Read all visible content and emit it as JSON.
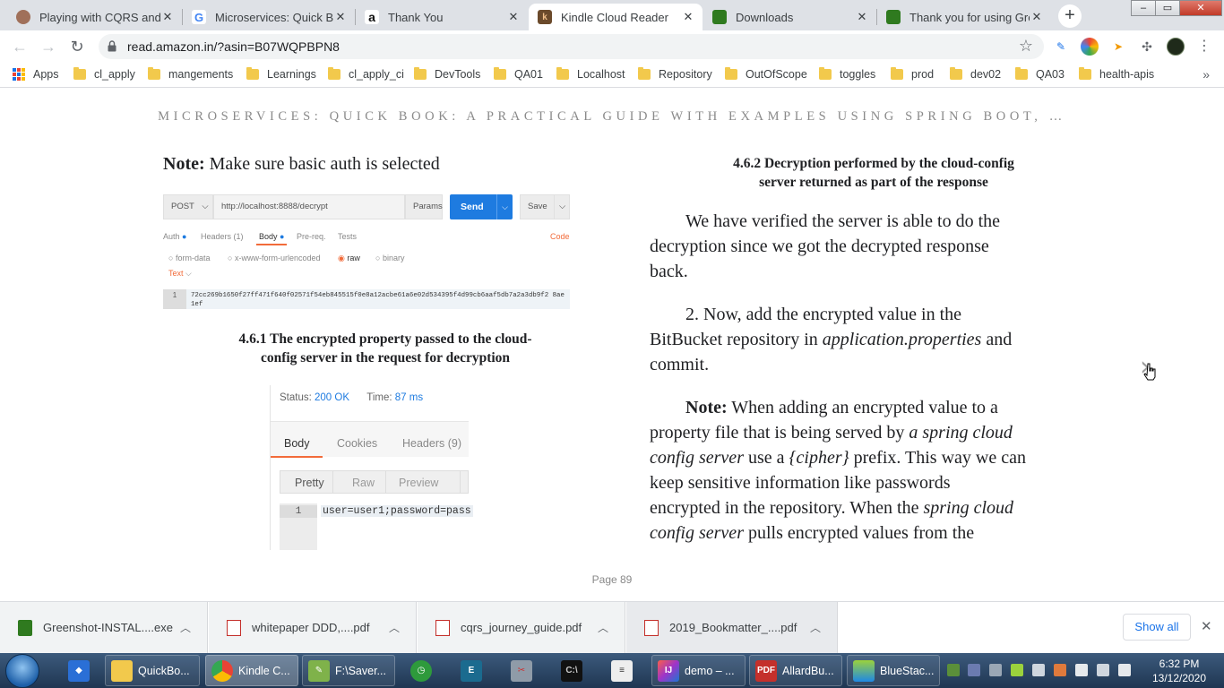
{
  "browser": {
    "tabs": [
      {
        "title": "Playing with CQRS and E",
        "favicon": "avatar-icon"
      },
      {
        "title": "Microservices: Quick Boo",
        "favicon": "google-icon"
      },
      {
        "title": "Thank You",
        "favicon": "amazon-icon"
      },
      {
        "title": "Kindle Cloud Reader",
        "favicon": "kindle-icon"
      },
      {
        "title": "Downloads",
        "favicon": "greenshot-icon"
      },
      {
        "title": "Thank you for using Gree",
        "favicon": "greenshot-icon"
      }
    ],
    "active_tab_index": 3,
    "url": "read.amazon.in/?asin=B07WQPBPN8"
  },
  "bookmarks": [
    {
      "label": "Apps",
      "type": "apps"
    },
    {
      "label": "cl_apply"
    },
    {
      "label": "mangements"
    },
    {
      "label": "Learnings"
    },
    {
      "label": "cl_apply_ci"
    },
    {
      "label": "DevTools"
    },
    {
      "label": "QA01"
    },
    {
      "label": "Localhost"
    },
    {
      "label": "Repository"
    },
    {
      "label": "OutOfScope"
    },
    {
      "label": "toggles"
    },
    {
      "label": "prod"
    },
    {
      "label": "dev02"
    },
    {
      "label": "QA03"
    },
    {
      "label": "health-apis"
    }
  ],
  "reader": {
    "book_title": "MICROSERVICES: QUICK BOOK: A PRACTICAL GUIDE WITH EXAMPLES USING SPRING BOOT, …",
    "left": {
      "note_label": "Note:",
      "note_text": " Make sure basic auth is selected",
      "caption1_line1": "4.6.1 The encrypted property passed to the cloud-",
      "caption1_line2": "config server in the request for decryption"
    },
    "right": {
      "caption2_line1": "4.6.2 Decryption performed by the cloud-config",
      "caption2_line2": "server returned as part of the response",
      "para1_l1": "We have verified the server is able to do the",
      "para1_l2": "decryption since we got the decrypted response",
      "para1_l3": "back.",
      "para2_l1": "2. Now, add the encrypted value in the",
      "para2_l2a": "BitBucket repository in ",
      "para2_l2b": "application.properties",
      "para2_l2c": " and",
      "para2_l3": "commit.",
      "para3_label": "Note:",
      "para3_l1": " When adding an encrypted value to a",
      "para3_l2a": "property file that is being served by ",
      "para3_l2b": "a spring cloud",
      "para3_l3a": "config server",
      "para3_l3b": " use a ",
      "para3_l3c": "{cipher}",
      "para3_l3d": " prefix. This way we can",
      "para3_l4": "keep sensitive information like passwords",
      "para3_l5a": "encrypted in the repository. When the ",
      "para3_l5b": "spring cloud",
      "para3_l6a": "config server",
      "para3_l6b": " pulls encrypted values from the"
    },
    "page_label": "Page 89"
  },
  "postman_request": {
    "method": "POST",
    "url": "http://localhost:8888/decrypt",
    "params": "Params",
    "send": "Send",
    "save": "Save",
    "tabs": [
      "Auth",
      "Headers (1)",
      "Body",
      "Pre-req.",
      "Tests"
    ],
    "code_link": "Code",
    "body_types": [
      "form-data",
      "x-www-form-urlencoded",
      "raw",
      "binary"
    ],
    "text_type": "Text",
    "line_no": "1",
    "body": "72cc269b1650f27ff471f640f02571f54eb845515f0e8a12acbe61a6e02d534395f4d99cb6aaf5db7a2a3db9f2 8ae1ef"
  },
  "postman_response": {
    "status_label": "Status:",
    "status_value": "200 OK",
    "time_label": "Time:",
    "time_value": "87 ms",
    "tabs": [
      "Body",
      "Cookies",
      "Headers (9)"
    ],
    "views": [
      "Pretty",
      "Raw",
      "Preview"
    ],
    "line_no": "1",
    "body": "user=user1;password=pass"
  },
  "downloads": [
    {
      "name": "Greenshot-INSTAL....exe",
      "icon": "greenshot-icon"
    },
    {
      "name": "whitepaper DDD,....pdf",
      "icon": "pdf-icon"
    },
    {
      "name": "cqrs_journey_guide.pdf",
      "icon": "pdf-icon"
    },
    {
      "name": "2019_Bookmatter_....pdf",
      "icon": "pdf-icon"
    }
  ],
  "downloads_show_all": "Show all",
  "taskbar": {
    "items": [
      {
        "label": "QuickBo...",
        "icon": "folder-icon"
      },
      {
        "label": "Kindle C...",
        "icon": "chrome-icon"
      },
      {
        "label": "F:\\Saver...",
        "icon": "notepad-icon"
      },
      {
        "label": "demo – ...",
        "icon": "intellij-icon"
      },
      {
        "label": "AllardBu...",
        "icon": "pdf-reader-icon"
      },
      {
        "label": "BlueStac...",
        "icon": "bluestacks-icon"
      }
    ],
    "time": "6:32 PM",
    "date": "13/12/2020"
  },
  "colors": {
    "accent": "#1e7be0",
    "folder": "#f2c94c",
    "postman_orange": "#f26b3a"
  }
}
